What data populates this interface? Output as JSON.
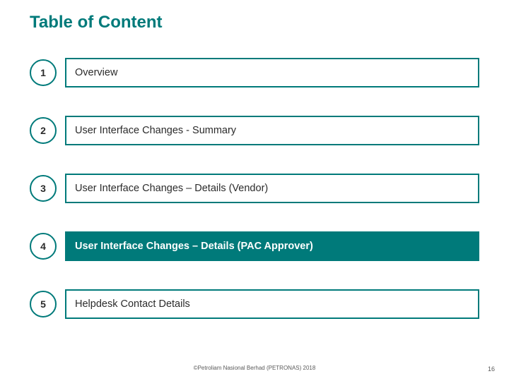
{
  "title": "Table of Content",
  "colors": {
    "accent": "#007a7a"
  },
  "toc": {
    "items": [
      {
        "num": "1",
        "label": "Overview",
        "active": false
      },
      {
        "num": "2",
        "label": "User Interface Changes - Summary",
        "active": false
      },
      {
        "num": "3",
        "label": "User Interface Changes – Details (Vendor)",
        "active": false
      },
      {
        "num": "4",
        "label": "User Interface Changes – Details (PAC Approver)",
        "active": true
      },
      {
        "num": "5",
        "label": "Helpdesk Contact Details",
        "active": false
      }
    ]
  },
  "footer": "©Petroliam Nasional Berhad (PETRONAS) 2018",
  "page_number": "16"
}
